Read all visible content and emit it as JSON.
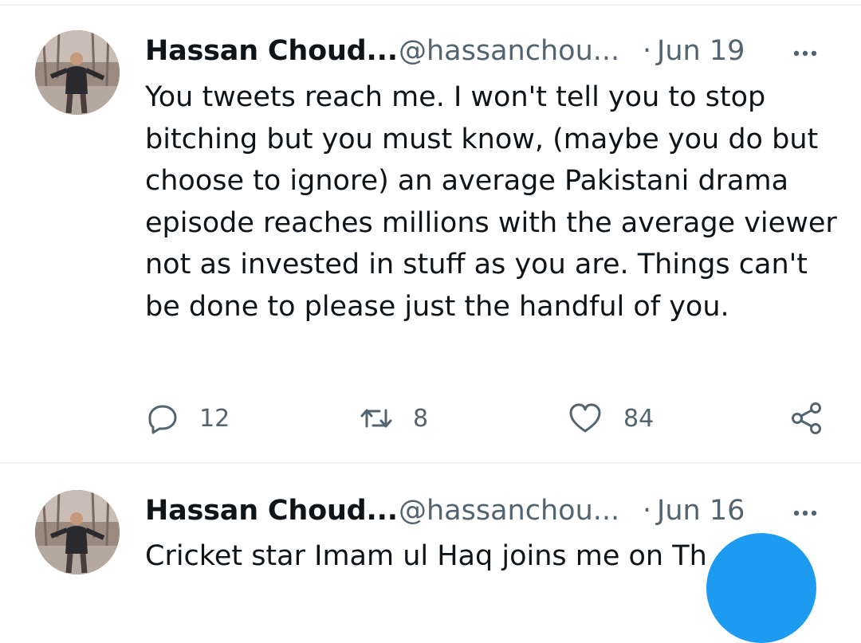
{
  "tweets": [
    {
      "author_name": "Hassan Choud...",
      "handle": "@hassanchou...",
      "separator": "·",
      "date": "Jun 19",
      "body": "You tweets reach me. I won't tell you to stop bitching but you must know, (maybe you do but choose to ignore) an average Pakistani drama episode reaches millions with the average viewer not as invested in stuff as you are. Things can't be done to please just the handful of you.",
      "reply_count": "12",
      "retweet_count": "8",
      "like_count": "84"
    },
    {
      "author_name": "Hassan Choud...",
      "handle": "@hassanchou...",
      "separator": "·",
      "date": "Jun 16",
      "body": "Cricket star Imam ul Haq joins me on Th"
    }
  ],
  "colors": {
    "primary_text": "#0f1419",
    "secondary_text": "#536471",
    "divider": "#eff3f4",
    "accent": "#1d9bf0"
  },
  "icons": [
    "more-icon",
    "reply-icon",
    "retweet-icon",
    "like-icon",
    "share-icon"
  ]
}
